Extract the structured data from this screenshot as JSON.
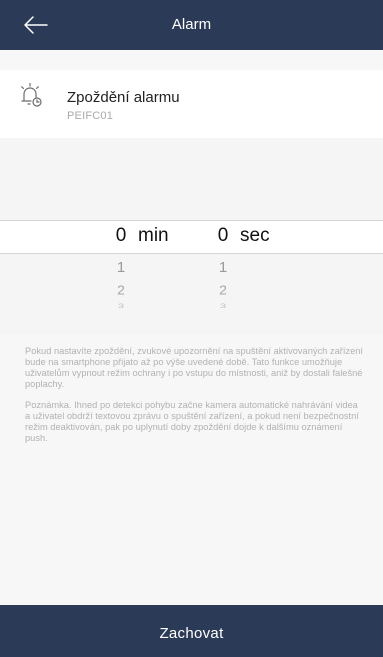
{
  "header": {
    "title": "Alarm",
    "back_icon": "arrow-left-icon"
  },
  "device": {
    "icon": "alarm-delay-icon",
    "name": "Zpoždění alarmu",
    "id": "PEIFC01"
  },
  "picker": {
    "minutes": {
      "selected": "0",
      "unit": "min",
      "options": [
        "1",
        "2",
        "3"
      ]
    },
    "seconds": {
      "selected": "0",
      "unit": "sec",
      "options": [
        "1",
        "2",
        "3"
      ]
    }
  },
  "info": {
    "paragraph1": "Pokud nastavíte zpoždění, zvukové upozornění na spuštění aktivovaných zařízení bude na smartphone přijato až po výše uvedené době. Tato funkce umožňuje uživatelům vypnout režim ochrany i po vstupu do místnosti, aniž by dostali falešné poplachy.",
    "paragraph2": "Poznámka. Ihned po detekci pohybu začne kamera automatické nahrávání videa a uživatel obdrží textovou zprávu o spuštění zařízení, a pokud není bezpečnostní režim deaktivován, pak po uplynutí doby zpoždění dojde k dalšímu oznámení push."
  },
  "footer": {
    "save_label": "Zachovat"
  },
  "colors": {
    "header_bg": "#2a3a57",
    "page_bg": "#f7f7f7",
    "info_text": "#b2b2b2"
  }
}
